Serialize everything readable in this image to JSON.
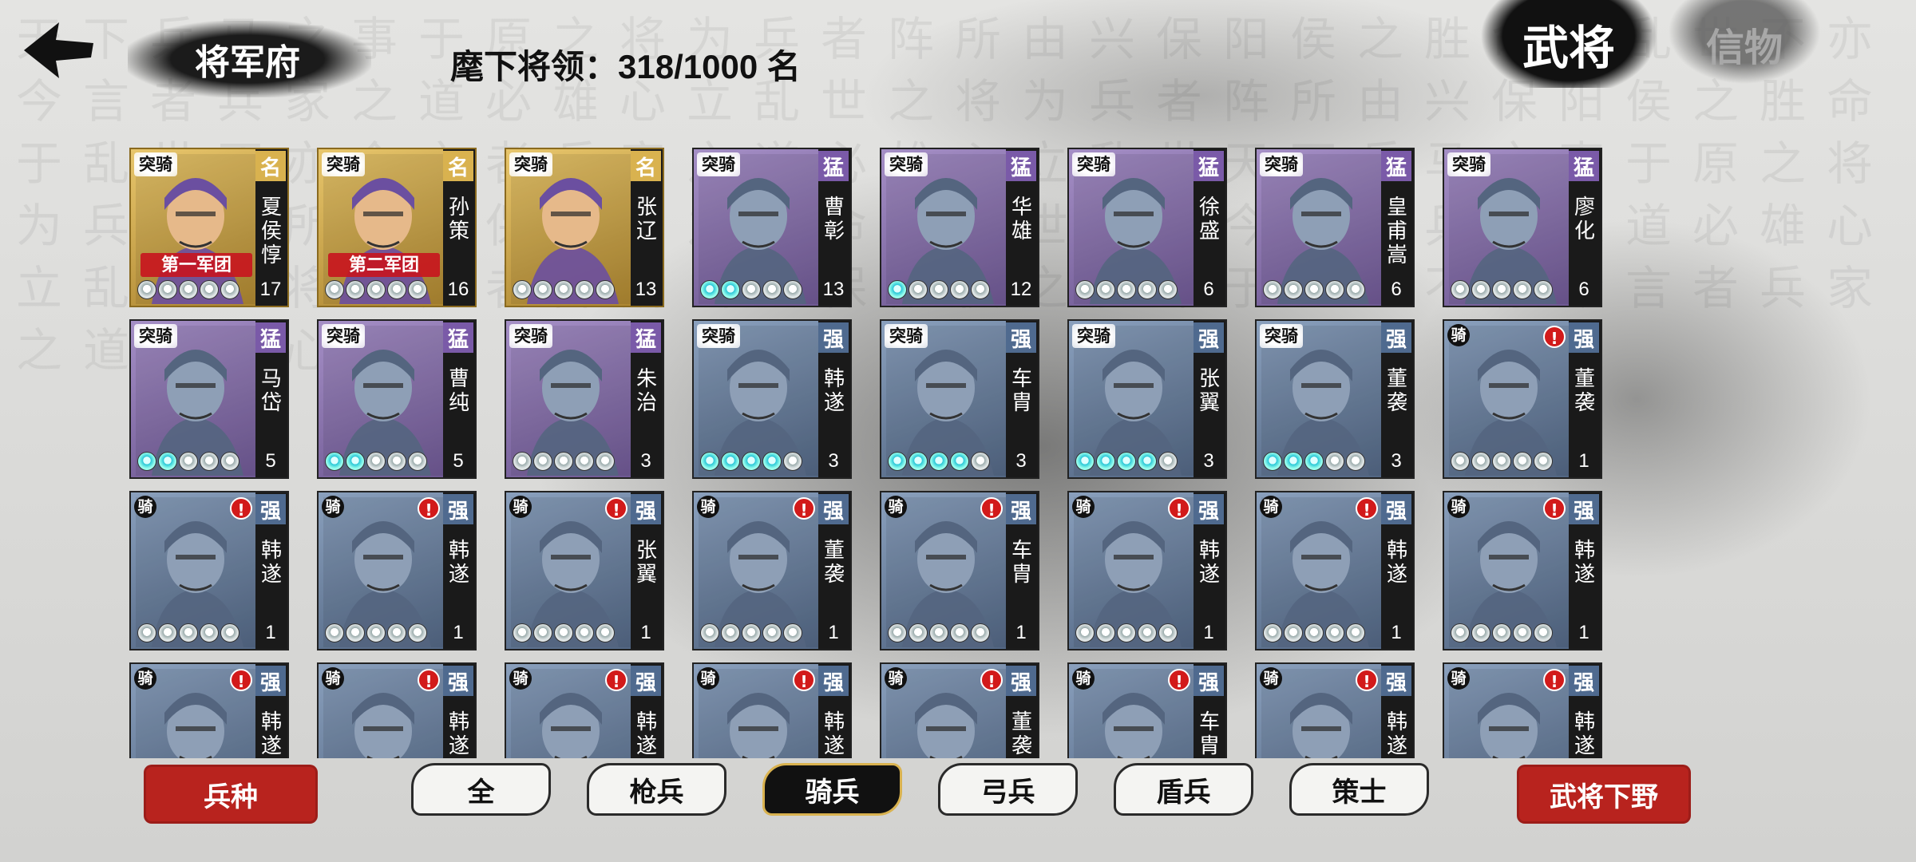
{
  "header": {
    "back_icon": "back-arrow-icon",
    "title": "将军府",
    "count_text": "麾下将领：318/1000 名"
  },
  "tabs": {
    "active": "武将",
    "inactive": "信物"
  },
  "colors": {
    "legend": "#d9b24f",
    "epic": "#7a5aa8",
    "rare": "#4f6a8f",
    "button_red": "#b8231e",
    "alert_red": "#d21a1a"
  },
  "cards": [
    {
      "type": "突骑",
      "tier": "名",
      "name": "夏侯惇",
      "level": "17",
      "rarity": "legend",
      "army": "第一军团",
      "alert": false,
      "stars": [
        0,
        0,
        0,
        0,
        0
      ]
    },
    {
      "type": "突骑",
      "tier": "名",
      "name": "孙策",
      "level": "16",
      "rarity": "legend",
      "army": "第二军团",
      "alert": false,
      "stars": [
        0,
        0,
        0,
        0,
        0
      ]
    },
    {
      "type": "突骑",
      "tier": "名",
      "name": "张辽",
      "level": "13",
      "rarity": "legend",
      "army": "",
      "alert": false,
      "stars": [
        0,
        0,
        0,
        0,
        0
      ]
    },
    {
      "type": "突骑",
      "tier": "猛",
      "name": "曹彰",
      "level": "13",
      "rarity": "epic",
      "army": "",
      "alert": false,
      "stars": [
        1,
        1,
        0,
        0,
        0
      ]
    },
    {
      "type": "突骑",
      "tier": "猛",
      "name": "华雄",
      "level": "12",
      "rarity": "epic",
      "army": "",
      "alert": false,
      "stars": [
        1,
        0,
        0,
        0,
        0
      ]
    },
    {
      "type": "突骑",
      "tier": "猛",
      "name": "徐盛",
      "level": "6",
      "rarity": "epic",
      "army": "",
      "alert": false,
      "stars": [
        0,
        0,
        0,
        0,
        0
      ]
    },
    {
      "type": "突骑",
      "tier": "猛",
      "name": "皇甫嵩",
      "level": "6",
      "rarity": "epic",
      "army": "",
      "alert": false,
      "stars": [
        0,
        0,
        0,
        0,
        0
      ]
    },
    {
      "type": "突骑",
      "tier": "猛",
      "name": "廖化",
      "level": "6",
      "rarity": "epic",
      "army": "",
      "alert": false,
      "stars": [
        0,
        0,
        0,
        0,
        0
      ]
    },
    {
      "type": "突骑",
      "tier": "猛",
      "name": "马岱",
      "level": "5",
      "rarity": "epic",
      "army": "",
      "alert": false,
      "stars": [
        1,
        1,
        0,
        0,
        0
      ]
    },
    {
      "type": "突骑",
      "tier": "猛",
      "name": "曹纯",
      "level": "5",
      "rarity": "epic",
      "army": "",
      "alert": false,
      "stars": [
        1,
        1,
        0,
        0,
        0
      ]
    },
    {
      "type": "突骑",
      "tier": "猛",
      "name": "朱治",
      "level": "3",
      "rarity": "epic",
      "army": "",
      "alert": false,
      "stars": [
        0,
        0,
        0,
        0,
        0
      ]
    },
    {
      "type": "突骑",
      "tier": "强",
      "name": "韩遂",
      "level": "3",
      "rarity": "rare",
      "army": "",
      "alert": false,
      "stars": [
        1,
        1,
        1,
        1,
        0
      ]
    },
    {
      "type": "突骑",
      "tier": "强",
      "name": "车胄",
      "level": "3",
      "rarity": "rare",
      "army": "",
      "alert": false,
      "stars": [
        1,
        1,
        1,
        1,
        0
      ]
    },
    {
      "type": "突骑",
      "tier": "强",
      "name": "张翼",
      "level": "3",
      "rarity": "rare",
      "army": "",
      "alert": false,
      "stars": [
        1,
        1,
        1,
        1,
        0
      ]
    },
    {
      "type": "突骑",
      "tier": "强",
      "name": "董袭",
      "level": "3",
      "rarity": "rare",
      "army": "",
      "alert": false,
      "stars": [
        1,
        1,
        1,
        0,
        0
      ]
    },
    {
      "type": "骑",
      "tier": "强",
      "name": "董袭",
      "level": "1",
      "rarity": "rare",
      "army": "",
      "alert": true,
      "stars": [
        0,
        0,
        0,
        0,
        0
      ]
    },
    {
      "type": "骑",
      "tier": "强",
      "name": "韩遂",
      "level": "1",
      "rarity": "rare",
      "army": "",
      "alert": true,
      "stars": [
        0,
        0,
        0,
        0,
        0
      ]
    },
    {
      "type": "骑",
      "tier": "强",
      "name": "韩遂",
      "level": "1",
      "rarity": "rare",
      "army": "",
      "alert": true,
      "stars": [
        0,
        0,
        0,
        0,
        0
      ]
    },
    {
      "type": "骑",
      "tier": "强",
      "name": "张翼",
      "level": "1",
      "rarity": "rare",
      "army": "",
      "alert": true,
      "stars": [
        0,
        0,
        0,
        0,
        0
      ]
    },
    {
      "type": "骑",
      "tier": "强",
      "name": "董袭",
      "level": "1",
      "rarity": "rare",
      "army": "",
      "alert": true,
      "stars": [
        0,
        0,
        0,
        0,
        0
      ]
    },
    {
      "type": "骑",
      "tier": "强",
      "name": "车胄",
      "level": "1",
      "rarity": "rare",
      "army": "",
      "alert": true,
      "stars": [
        0,
        0,
        0,
        0,
        0
      ]
    },
    {
      "type": "骑",
      "tier": "强",
      "name": "韩遂",
      "level": "1",
      "rarity": "rare",
      "army": "",
      "alert": true,
      "stars": [
        0,
        0,
        0,
        0,
        0
      ]
    },
    {
      "type": "骑",
      "tier": "强",
      "name": "韩遂",
      "level": "1",
      "rarity": "rare",
      "army": "",
      "alert": true,
      "stars": [
        0,
        0,
        0,
        0,
        0
      ]
    },
    {
      "type": "骑",
      "tier": "强",
      "name": "韩遂",
      "level": "1",
      "rarity": "rare",
      "army": "",
      "alert": true,
      "stars": [
        0,
        0,
        0,
        0,
        0
      ]
    },
    {
      "type": "骑",
      "tier": "强",
      "name": "韩遂",
      "level": "",
      "rarity": "rare",
      "army": "",
      "alert": true,
      "stars": []
    },
    {
      "type": "骑",
      "tier": "强",
      "name": "韩遂",
      "level": "",
      "rarity": "rare",
      "army": "",
      "alert": true,
      "stars": []
    },
    {
      "type": "骑",
      "tier": "强",
      "name": "韩遂",
      "level": "",
      "rarity": "rare",
      "army": "",
      "alert": true,
      "stars": []
    },
    {
      "type": "骑",
      "tier": "强",
      "name": "韩遂",
      "level": "",
      "rarity": "rare",
      "army": "",
      "alert": true,
      "stars": []
    },
    {
      "type": "骑",
      "tier": "强",
      "name": "董袭",
      "level": "",
      "rarity": "rare",
      "army": "",
      "alert": true,
      "stars": []
    },
    {
      "type": "骑",
      "tier": "强",
      "name": "车胄",
      "level": "",
      "rarity": "rare",
      "army": "",
      "alert": true,
      "stars": []
    },
    {
      "type": "骑",
      "tier": "强",
      "name": "韩遂",
      "level": "",
      "rarity": "rare",
      "army": "",
      "alert": true,
      "stars": []
    },
    {
      "type": "骑",
      "tier": "强",
      "name": "韩遂",
      "level": "",
      "rarity": "rare",
      "army": "",
      "alert": true,
      "stars": []
    }
  ],
  "bottom": {
    "troop_button": "兵种",
    "filters": [
      "全",
      "枪兵",
      "骑兵",
      "弓兵",
      "盾兵",
      "策士"
    ],
    "selected_filter": "骑兵",
    "dismiss_button": "武将下野"
  }
}
